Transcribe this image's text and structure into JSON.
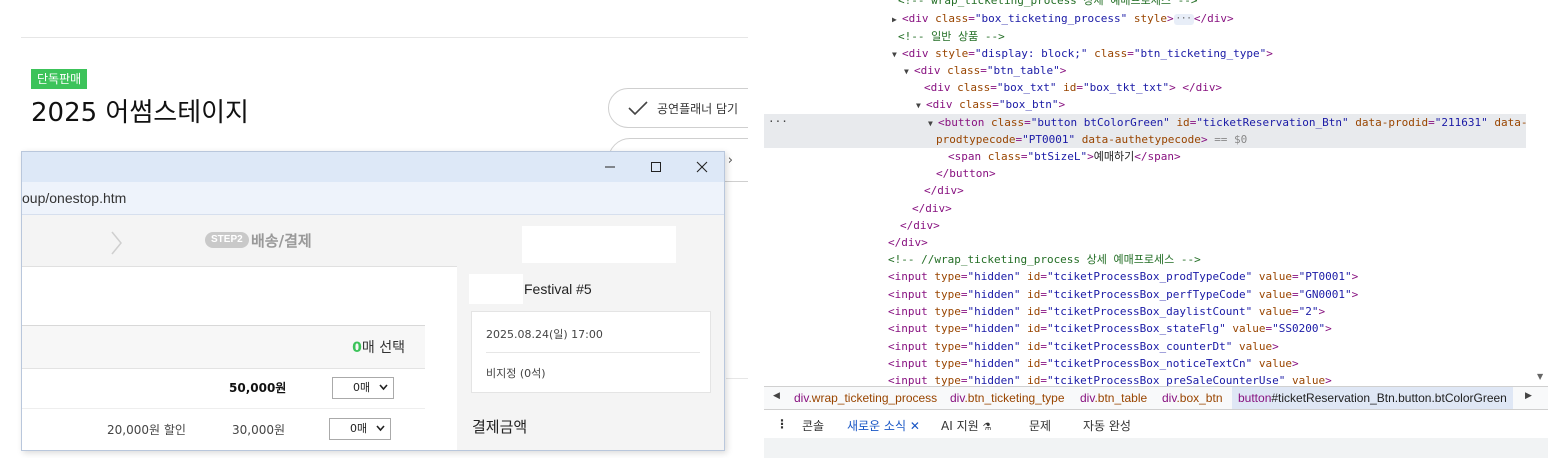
{
  "page": {
    "badge": "단독판매",
    "title": "2025 어썸스테이지",
    "planner_button": "공연플래너 담기"
  },
  "popup": {
    "address": "oup/onestop.htm",
    "step2_pill": "STEP2",
    "step2_label": "배송/결제",
    "select_count_num": "0",
    "select_count_suffix": "매 선택",
    "rows": [
      {
        "discount": "",
        "price": "50,000원",
        "qty": "0매"
      },
      {
        "discount": "20,000원 할인",
        "price": "30,000원",
        "qty": "0매"
      }
    ],
    "festival_title": "Festival #5",
    "date": "2025.08.24(일) 17:00",
    "seat": "비지정 (0석)",
    "payment_label": "결제금액"
  },
  "devtools": {
    "breadcrumbs": [
      {
        "tag": "div",
        "cls": ".wrap_ticketing_process"
      },
      {
        "tag": "div",
        "cls": ".btn_ticketing_type"
      },
      {
        "tag": "div",
        "cls": ".btn_table"
      },
      {
        "tag": "div",
        "cls": ".box_btn"
      },
      {
        "tag": "button",
        "cls": "#ticketReservation_Btn.button.btColorGreen"
      }
    ],
    "tabs": {
      "console": "콘솔",
      "news": "새로운 소식",
      "ai": "AI 지원",
      "issues": "문제",
      "autofill": "자동 완성"
    }
  }
}
